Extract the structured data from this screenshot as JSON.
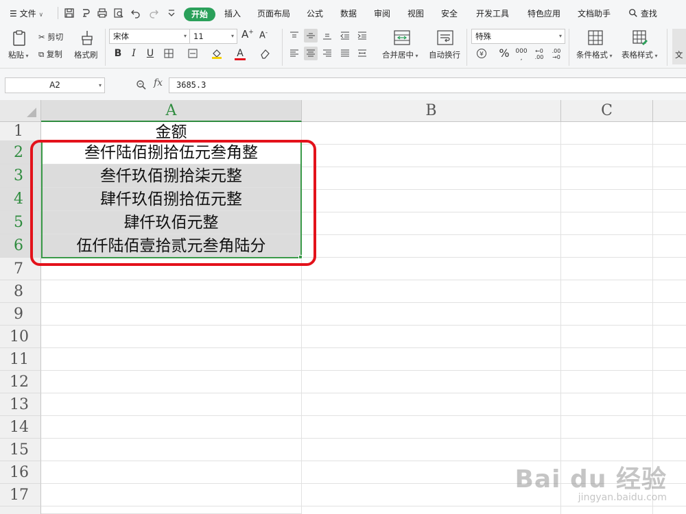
{
  "menubar": {
    "file_label": "文件",
    "tabs": [
      "开始",
      "插入",
      "页面布局",
      "公式",
      "数据",
      "审阅",
      "视图",
      "安全",
      "开发工具",
      "特色应用",
      "文档助手"
    ],
    "search_label": "查找"
  },
  "ribbon": {
    "paste_label": "粘贴",
    "cut_label": "剪切",
    "copy_label": "复制",
    "format_painter_label": "格式刷",
    "font_name": "宋体",
    "font_size": "11",
    "merge_label": "合并居中",
    "wrap_label": "自动换行",
    "number_format": "特殊",
    "percent_symbol": "%",
    "conditional_format_label": "条件格式",
    "table_style_label": "表格样式",
    "doc_label": "文"
  },
  "formula_bar": {
    "name_box": "A2",
    "fx_label": "fx",
    "formula": "3685.3"
  },
  "sheet": {
    "columns": [
      "A",
      "B",
      "C"
    ],
    "rows": [
      "1",
      "2",
      "3",
      "4",
      "5",
      "6",
      "7",
      "8",
      "9",
      "10",
      "11",
      "12",
      "13",
      "14",
      "15",
      "16",
      "17"
    ],
    "cells": {
      "A1": "金额",
      "A2": "叁仟陆佰捌拾伍元叁角整",
      "A3": "叁仟玖佰捌拾柒元整",
      "A4": "肆仟玖佰捌拾伍元整",
      "A5": "肆仟玖佰元整",
      "A6": "伍仟陆佰壹拾贰元叁角陆分"
    }
  },
  "watermark": {
    "brand": "Bai du 经验",
    "url": "jingyan.baidu.com"
  }
}
